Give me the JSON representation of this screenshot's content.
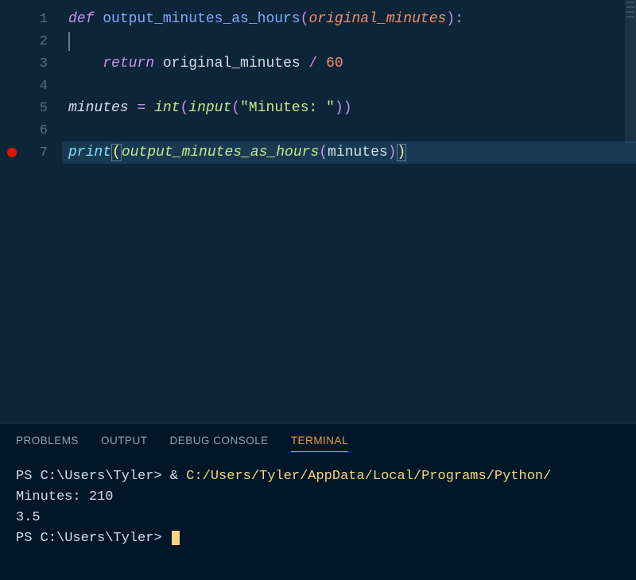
{
  "editor": {
    "lines": [
      {
        "num": "1",
        "breakpoint": false
      },
      {
        "num": "2",
        "breakpoint": false
      },
      {
        "num": "3",
        "breakpoint": false
      },
      {
        "num": "4",
        "breakpoint": false
      },
      {
        "num": "5",
        "breakpoint": false
      },
      {
        "num": "6",
        "breakpoint": false
      },
      {
        "num": "7",
        "breakpoint": true
      }
    ],
    "code": {
      "l1": {
        "def": "def ",
        "fn": "output_minutes_as_hours",
        "paren_o": "(",
        "param": "original_minutes",
        "paren_c": ")",
        "colon": ":"
      },
      "l3": {
        "indent": "    ",
        "return": "return ",
        "ident": "original_minutes",
        "sp1": " ",
        "op": "/",
        "sp2": " ",
        "num": "60"
      },
      "l5": {
        "ident": "minutes",
        "sp1": " ",
        "eq": "=",
        "sp2": " ",
        "intfn": "int",
        "paren_o1": "(",
        "inputfn": "input",
        "paren_o2": "(",
        "str": "\"Minutes: \"",
        "paren_c2": ")",
        "paren_c1": ")"
      },
      "l7": {
        "printfn": "print",
        "paren_o1": "(",
        "fn": "output_minutes_as_hours",
        "paren_o2": "(",
        "arg": "minutes",
        "paren_c2": ")",
        "paren_c1": ")"
      }
    }
  },
  "panel": {
    "tabs": {
      "problems": "PROBLEMS",
      "output": "OUTPUT",
      "debug": "DEBUG CONSOLE",
      "terminal": "TERMINAL"
    },
    "terminal": {
      "line1_prompt": "PS C:\\Users\\Tyler> ",
      "line1_amp": "& ",
      "line1_cmd": "C:/Users/Tyler/AppData/Local/Programs/Python/",
      "line2": "Minutes: 210",
      "line3": "3.5",
      "line4_prompt": "PS C:\\Users\\Tyler> "
    }
  }
}
